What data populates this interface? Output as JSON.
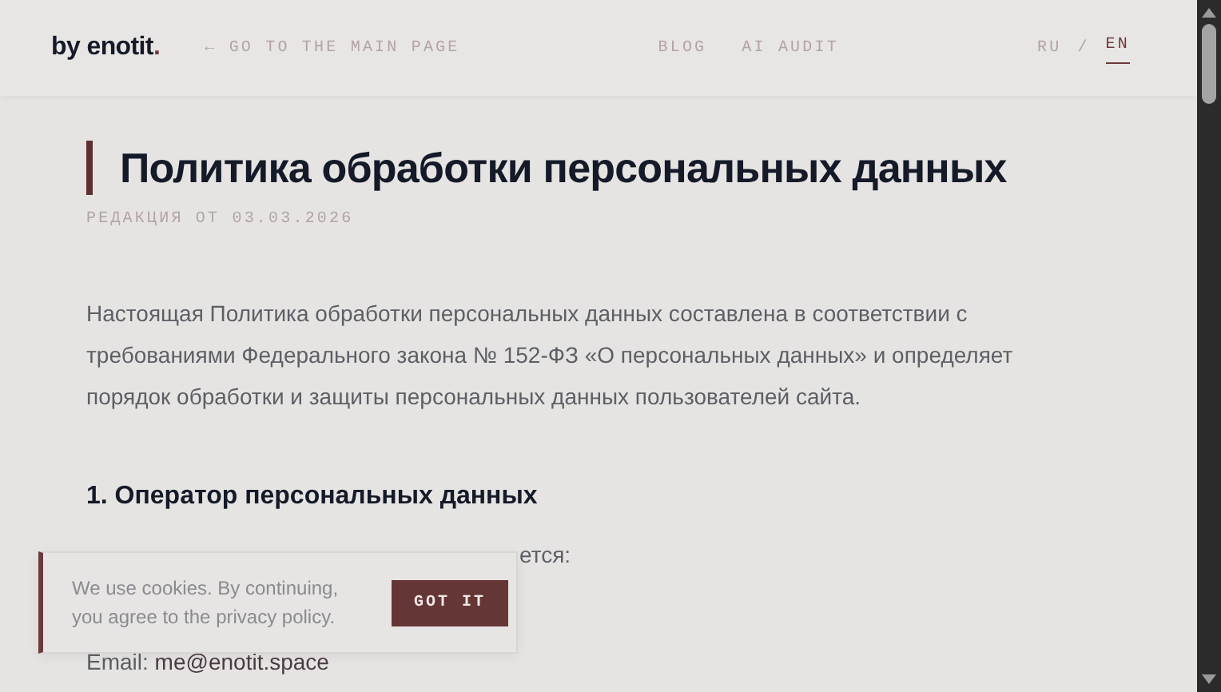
{
  "header": {
    "logo": {
      "text": "by enotit",
      "accent": "."
    },
    "back_link": "← GO TO THE MAIN PAGE",
    "nav": [
      {
        "label": "BLOG"
      },
      {
        "label": "AI AUDIT"
      }
    ],
    "languages": [
      {
        "label": "RU",
        "selected": false
      },
      {
        "label": "EN",
        "selected": true
      }
    ],
    "language_separator": "/"
  },
  "page": {
    "title": "Политика обработки персональных данных",
    "revision": "РЕДАКЦИЯ ОТ 03.03.2026",
    "intro": "Настоящая Политика обработки персональных данных составлена в соответствии с требованиями Федерального закона № 152-ФЗ «О персональных данных» и определяет порядок обработки и защиты персональных данных пользователей сайта.",
    "sections": [
      {
        "heading": "1. Оператор персональных данных",
        "lines": [
          {
            "text": "ется:"
          },
          {
            "label": "Email:",
            "value": "me@enotit.space"
          }
        ]
      }
    ]
  },
  "cookie_banner": {
    "text_before": "We use cookies. By continuing, you agree to the",
    "link": "privacy policy",
    "text_after": ".",
    "button": "GOT IT"
  }
}
